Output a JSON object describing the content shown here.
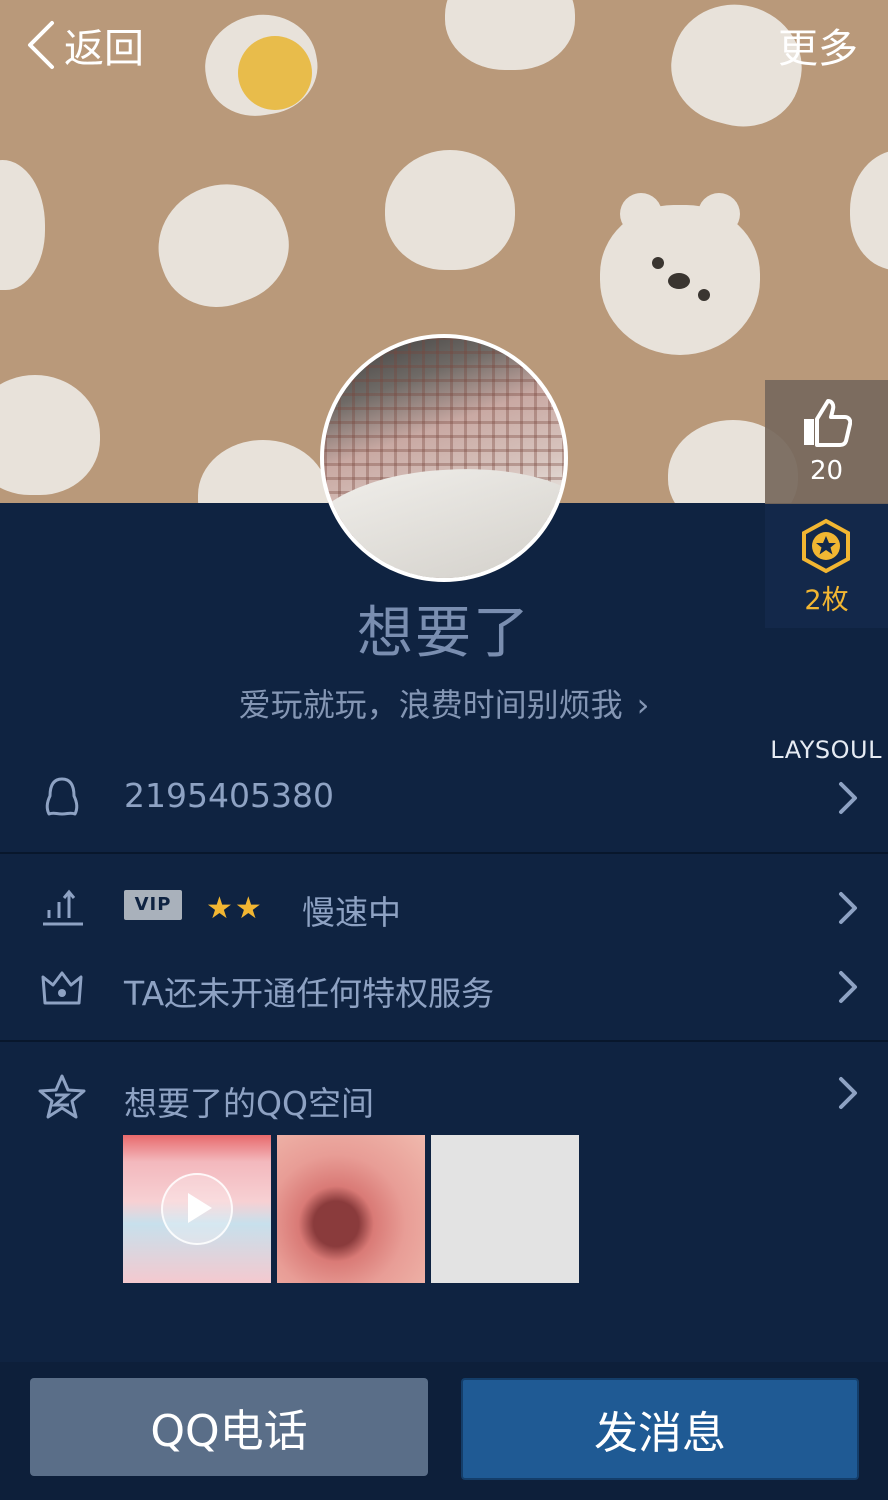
{
  "nav": {
    "back_label": "返回",
    "more_label": "更多"
  },
  "side": {
    "like_count": "20",
    "badge_count": "2枚"
  },
  "profile": {
    "name": "想要了",
    "signature": "爱玩就玩，浪费时间别烦我"
  },
  "watermark": "LAYSOUL",
  "rows": {
    "qq_number": "2195405380",
    "vip_tag": "VIP",
    "vip_stars": "★★",
    "vip_status": "慢速中",
    "privilege": "TA还未开通任何特权服务",
    "qzone": "想要了的QQ空间"
  },
  "buttons": {
    "call": "QQ电话",
    "message": "发消息"
  },
  "colors": {
    "background": "#0f2341",
    "accent_gold": "#f2b632",
    "message_button": "#1f5a94",
    "call_button": "#5a6e88"
  }
}
